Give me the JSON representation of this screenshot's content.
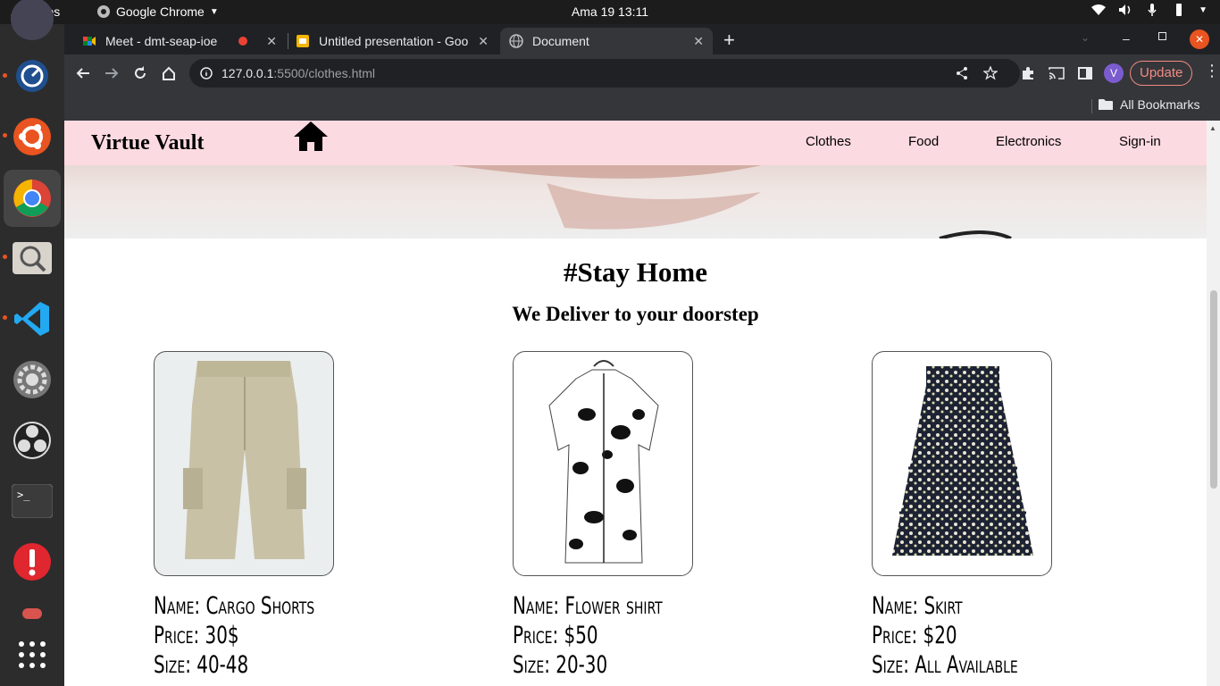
{
  "system": {
    "activities": "Activities",
    "app_name": "Google Chrome",
    "clock": "Ama 19  13:11"
  },
  "browser": {
    "tabs": [
      {
        "title": "Meet - dmt-seap-ioe",
        "recording": true
      },
      {
        "title": "Untitled presentation - Goo"
      },
      {
        "title": "Document",
        "active": true
      }
    ],
    "new_tab_label": "+",
    "url_host": "127.0.0.1",
    "url_path": ":5500/clothes.html",
    "update_label": "Update",
    "profile_initial": "V",
    "bookmarks_label": "All Bookmarks"
  },
  "page": {
    "brand": "Virtue Vault",
    "nav": [
      "Clothes",
      "Food",
      "Electronics",
      "Sign-in"
    ],
    "heading": "#Stay Home",
    "subheading": "We Deliver to your doorstep",
    "products": [
      {
        "name": "Name: Cargo Shorts",
        "price": "Price: 30$",
        "size": "Size: 40-48",
        "icon": "cargo-shorts-image"
      },
      {
        "name": "Name: Flower shirt",
        "price": "Price: $50",
        "size": "Size: 20-30",
        "icon": "flower-shirt-image"
      },
      {
        "name": "Name: Skirt",
        "price": "Price: $20",
        "size": "Size: All Available",
        "icon": "floral-skirt-image"
      }
    ]
  },
  "colors": {
    "navbar": "#fcdae1",
    "update_border": "#f28b82",
    "update_text": "#f28b82",
    "profile_bg": "#7b5ccf"
  }
}
